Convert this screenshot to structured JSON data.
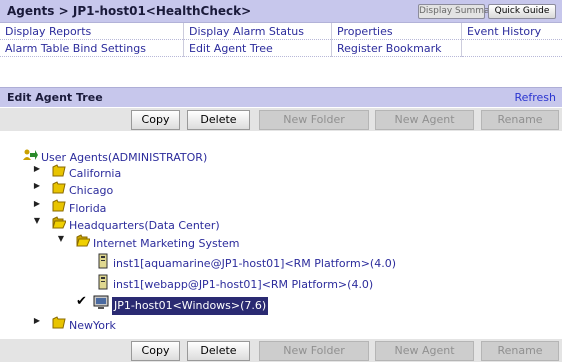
{
  "header": {
    "breadcrumb": "Agents > JP1-host01<HealthCheck>",
    "display_summary": "Display Summary",
    "quick_guide": "Quick Guide"
  },
  "menu": {
    "row1": [
      "Display Reports",
      "Display Alarm Status",
      "Properties",
      "Event History"
    ],
    "row2": [
      "Alarm Table Bind Settings",
      "Edit Agent Tree",
      "Register Bookmark",
      ""
    ]
  },
  "section": {
    "title": "Edit Agent Tree",
    "refresh": "Refresh"
  },
  "toolbar": {
    "copy": "Copy",
    "delete": "Delete",
    "new_folder": "New Folder",
    "new_agent": "New Agent",
    "rename": "Rename"
  },
  "tree": {
    "root": "User Agents(ADMINISTRATOR)",
    "california": "California",
    "chicago": "Chicago",
    "florida": "Florida",
    "headquarters": "Headquarters(Data Center)",
    "ims": "Internet Marketing System",
    "inst1": "inst1[aquamarine@JP1-host01]<RM Platform>(4.0)",
    "inst2": "inst1[webapp@JP1-host01]<RM Platform>(4.0)",
    "host": "JP1-host01<Windows>(7.6)",
    "newyork": "NewYork"
  },
  "colors": {
    "header_bg": "#c7c7ec",
    "link": "#2c2c9c",
    "selection": "#2a2a72",
    "folder": "#e8c400"
  }
}
